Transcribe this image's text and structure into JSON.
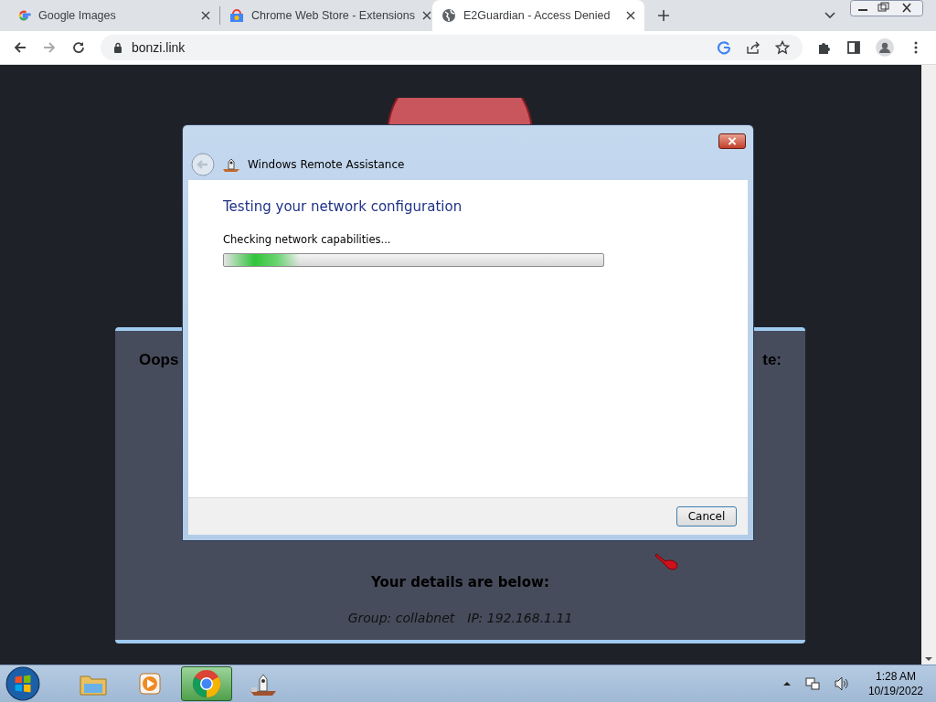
{
  "browser": {
    "tabs": [
      {
        "title": "Google Images",
        "selected": false
      },
      {
        "title": "Chrome Web Store - Extensions",
        "selected": false
      },
      {
        "title": "E2Guardian - Access Denied",
        "selected": true
      }
    ],
    "address": "bonzi.link"
  },
  "page": {
    "heading_left": "Oops",
    "heading_right": "te:",
    "details_title": "Your details are below:",
    "group": "Group: collabnet",
    "ip": "IP: 192.168.1.11"
  },
  "dialog": {
    "title": "Windows Remote Assistance",
    "heading": "Testing your network configuration",
    "status": "Checking network capabilities...",
    "level": 0.2,
    "buttons": [
      "Cancel"
    ]
  },
  "taskbar": {
    "apps": [
      {
        "kind": "folder",
        "selected": false
      },
      {
        "kind": "media",
        "selected": false
      },
      {
        "kind": "chrome",
        "selected": true
      },
      {
        "kind": "assist",
        "selected": false
      }
    ],
    "time": "1:28 AM",
    "date": "10/19/2022"
  }
}
